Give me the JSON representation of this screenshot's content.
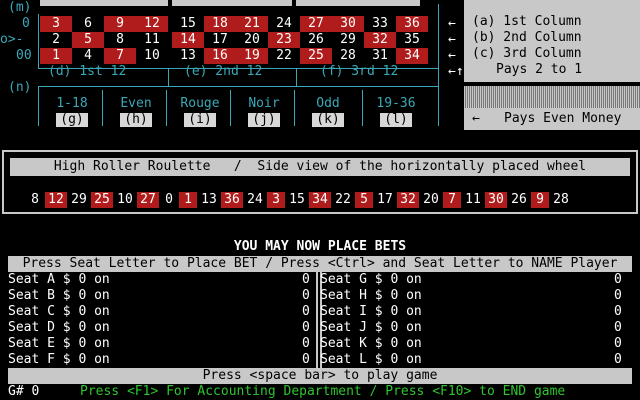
{
  "board": {
    "left_labels": [
      "(m)",
      "0",
      "o>-",
      "00",
      "(n)"
    ],
    "rows": [
      [
        {
          "n": "3",
          "c": "red"
        },
        {
          "n": "6",
          "c": "blk"
        },
        {
          "n": "9",
          "c": "red"
        },
        {
          "n": "12",
          "c": "red"
        },
        {
          "n": "15",
          "c": "blk"
        },
        {
          "n": "18",
          "c": "red"
        },
        {
          "n": "21",
          "c": "red"
        },
        {
          "n": "24",
          "c": "blk"
        },
        {
          "n": "27",
          "c": "red"
        },
        {
          "n": "30",
          "c": "red"
        },
        {
          "n": "33",
          "c": "blk"
        },
        {
          "n": "36",
          "c": "red"
        }
      ],
      [
        {
          "n": "2",
          "c": "blk"
        },
        {
          "n": "5",
          "c": "red"
        },
        {
          "n": "8",
          "c": "blk"
        },
        {
          "n": "11",
          "c": "blk"
        },
        {
          "n": "14",
          "c": "red"
        },
        {
          "n": "17",
          "c": "blk"
        },
        {
          "n": "20",
          "c": "blk"
        },
        {
          "n": "23",
          "c": "red"
        },
        {
          "n": "26",
          "c": "blk"
        },
        {
          "n": "29",
          "c": "blk"
        },
        {
          "n": "32",
          "c": "red"
        },
        {
          "n": "35",
          "c": "blk"
        }
      ],
      [
        {
          "n": "1",
          "c": "red"
        },
        {
          "n": "4",
          "c": "blk"
        },
        {
          "n": "7",
          "c": "red"
        },
        {
          "n": "10",
          "c": "blk"
        },
        {
          "n": "13",
          "c": "blk"
        },
        {
          "n": "16",
          "c": "red"
        },
        {
          "n": "19",
          "c": "red"
        },
        {
          "n": "22",
          "c": "blk"
        },
        {
          "n": "25",
          "c": "red"
        },
        {
          "n": "28",
          "c": "blk"
        },
        {
          "n": "31",
          "c": "blk"
        },
        {
          "n": "34",
          "c": "red"
        }
      ]
    ],
    "dozens": [
      "(d) 1st 12",
      "(e) 2nd 12",
      "(f) 3rd 12"
    ],
    "even_bets": [
      {
        "label": "1-18",
        "key": "(g)"
      },
      {
        "label": "Even",
        "key": "(h)"
      },
      {
        "label": "Rouge",
        "key": "(i)"
      },
      {
        "label": "Noir",
        "key": "(j)"
      },
      {
        "label": "Odd",
        "key": "(k)"
      },
      {
        "label": "19-36",
        "key": "(l)"
      }
    ],
    "column_arrows": [
      "←",
      "←",
      "←",
      "←↑"
    ],
    "column_bets": [
      "(a) 1st Column",
      "(b) 2nd Column",
      "(c) 3rd Column",
      "Pays 2 to 1"
    ],
    "even_money_arrow": "←",
    "even_money_text": "Pays Even Money"
  },
  "wheel": {
    "title": "High Roller Roulette   /  Side view of the horizontally placed wheel",
    "numbers": [
      {
        "n": "8",
        "c": "blk"
      },
      {
        "n": "12",
        "c": "red"
      },
      {
        "n": "29",
        "c": "blk"
      },
      {
        "n": "25",
        "c": "red"
      },
      {
        "n": "10",
        "c": "blk"
      },
      {
        "n": "27",
        "c": "red"
      },
      {
        "n": "0",
        "c": "blk"
      },
      {
        "n": "1",
        "c": "red"
      },
      {
        "n": "13",
        "c": "blk"
      },
      {
        "n": "36",
        "c": "red"
      },
      {
        "n": "24",
        "c": "blk"
      },
      {
        "n": "3",
        "c": "red"
      },
      {
        "n": "15",
        "c": "blk"
      },
      {
        "n": "34",
        "c": "red"
      },
      {
        "n": "22",
        "c": "blk"
      },
      {
        "n": "5",
        "c": "red"
      },
      {
        "n": "17",
        "c": "blk"
      },
      {
        "n": "32",
        "c": "red"
      },
      {
        "n": "20",
        "c": "blk"
      },
      {
        "n": "7",
        "c": "red"
      },
      {
        "n": "11",
        "c": "blk"
      },
      {
        "n": "30",
        "c": "red"
      },
      {
        "n": "26",
        "c": "blk"
      },
      {
        "n": "9",
        "c": "red"
      },
      {
        "n": "28",
        "c": "blk"
      }
    ]
  },
  "status": {
    "place_bets": "YOU MAY NOW PLACE BETS",
    "instructions": "Press Seat Letter to Place BET / Press <Ctrl> and Seat Letter to NAME Player",
    "space_bar": "Press <space bar> to play game",
    "game_number": "G# 0",
    "footer": "Press <F1> For Accounting Department / Press <F10> to END game"
  },
  "seats_left": [
    {
      "label": "Seat A $ 0 on",
      "value": "0"
    },
    {
      "label": "Seat B $ 0 on",
      "value": "0"
    },
    {
      "label": "Seat C $ 0 on",
      "value": "0"
    },
    {
      "label": "Seat D $ 0 on",
      "value": "0"
    },
    {
      "label": "Seat E $ 0 on",
      "value": "0"
    },
    {
      "label": "Seat F $ 0 on",
      "value": "0"
    }
  ],
  "seats_right": [
    {
      "label": "Seat G $ 0 on",
      "value": "0"
    },
    {
      "label": "Seat H $ 0 on",
      "value": "0"
    },
    {
      "label": "Seat I $ 0 on",
      "value": "0"
    },
    {
      "label": "Seat J $ 0 on",
      "value": "0"
    },
    {
      "label": "Seat K $ 0 on",
      "value": "0"
    },
    {
      "label": "Seat L $ 0 on",
      "value": "0"
    }
  ],
  "colors": {
    "red": "#b01c1c",
    "cyan": "#3aa7b8",
    "gray": "#c8c8c8",
    "green": "#2ec42e"
  }
}
